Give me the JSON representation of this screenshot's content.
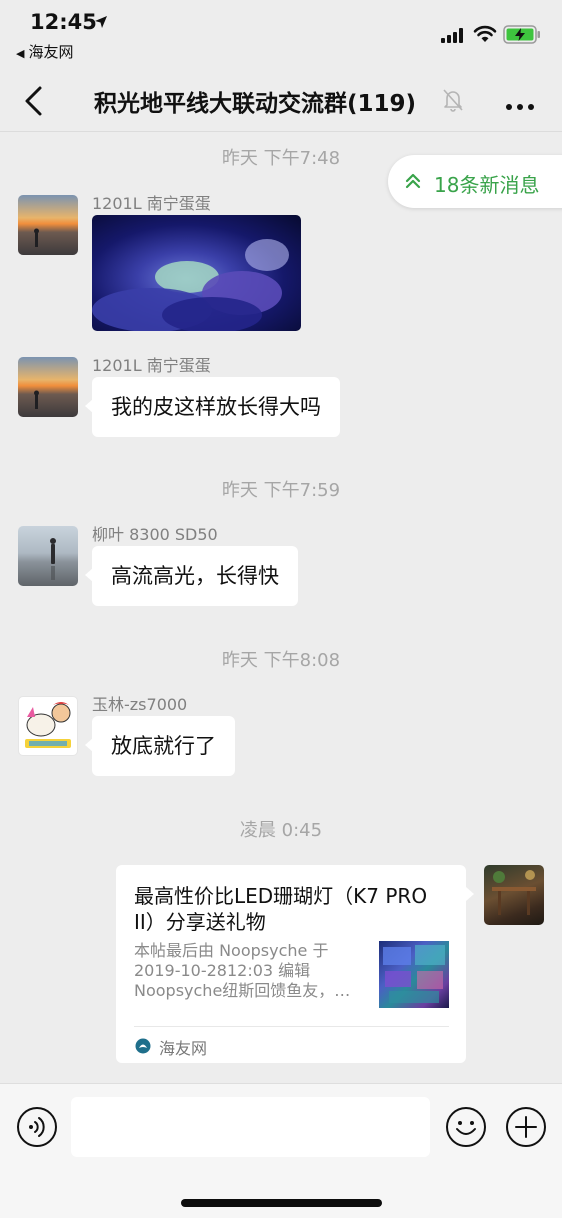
{
  "status_bar": {
    "time": "12:45",
    "back_app": "海友网",
    "icons": [
      "location-arrow-icon",
      "cellular-signal-icon",
      "wifi-icon",
      "battery-charging-icon"
    ]
  },
  "nav": {
    "title": "积光地平线大联动交流群(119)",
    "back_icon": "chevron-left-icon",
    "mute_icon": "bell-slash-icon",
    "more_icon": "ellipsis-icon"
  },
  "new_messages": {
    "label": "18条新消息",
    "icon": "double-chevron-up-icon"
  },
  "messages": [
    {
      "timestamp": "昨天 下午7:48"
    },
    {
      "sender": "1201L 南宁蛋蛋",
      "type": "image"
    },
    {
      "sender": "1201L 南宁蛋蛋",
      "text": "我的皮这样放长得大吗"
    },
    {
      "timestamp": "昨天 下午7:59"
    },
    {
      "sender": "柳叶 8300 SD50",
      "text": "高流高光，长得快"
    },
    {
      "timestamp": "昨天 下午8:08"
    },
    {
      "sender": "玉林-zs7000",
      "text": "放底就行了"
    },
    {
      "timestamp": "凌晨 0:45"
    },
    {
      "type": "link-card",
      "title": "最高性价比LED珊瑚灯（K7 PRO II）分享送礼物",
      "desc_lines": [
        "本帖最后由 Noopsyche 于",
        "2019-10-2812:03 编辑",
        "Noopsyche纽斯回馈鱼友，…"
      ],
      "source": "海友网"
    }
  ],
  "input_bar": {
    "placeholder": "",
    "icons": [
      "voice-icon",
      "emoji-icon",
      "plus-icon"
    ]
  },
  "colors": {
    "background": "#ededed",
    "accent_green": "#39a34a",
    "bubble": "#ffffff",
    "timestamp": "#a6a6a6"
  }
}
